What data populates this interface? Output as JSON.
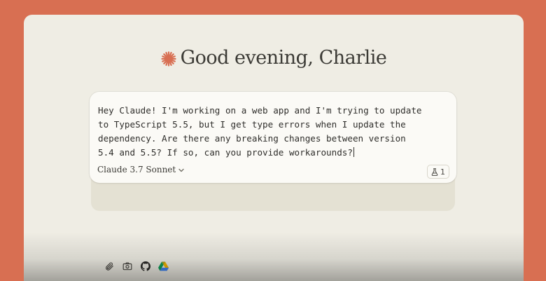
{
  "greeting": {
    "text": "Good evening, Charlie",
    "icon": "claude-burst-icon",
    "icon_color": "#d86f52"
  },
  "composer": {
    "message": "Hey Claude! I'm working on a web app and I'm trying to update to TypeScript 5.5, but I get type errors when I update the dependency. Are there any breaking changes between version 5.4 and 5.5? If so, can you provide workarounds?",
    "model_selector": {
      "label": "Claude 3.7 Sonnet",
      "icon": "chevron-down-icon"
    },
    "badge": {
      "icon": "flask-icon",
      "count": "1"
    },
    "tools": [
      {
        "name": "attach-file",
        "icon": "paperclip-icon"
      },
      {
        "name": "screenshot",
        "icon": "camera-icon"
      },
      {
        "name": "github",
        "icon": "github-icon"
      },
      {
        "name": "google-drive",
        "icon": "google-drive-icon"
      }
    ]
  },
  "colors": {
    "background": "#d86f52",
    "window": "#efede4",
    "card": "#fbfaf6",
    "tray": "#e4e1d3",
    "text": "#2f2e2b"
  }
}
